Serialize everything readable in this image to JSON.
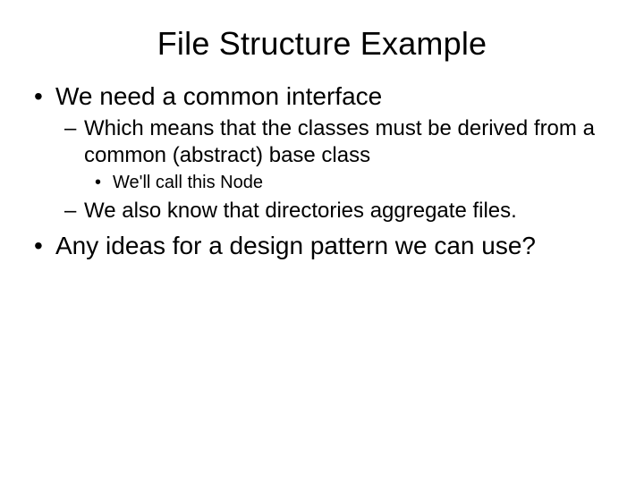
{
  "title": "File Structure Example",
  "bullets": {
    "b1": "We need a common interface",
    "b1_1": "Which means that the classes must be derived from a common (abstract) base class",
    "b1_1_1": "We'll call this Node",
    "b1_2": "We also know that directories aggregate files.",
    "b2": "Any ideas for a design pattern we can use?"
  }
}
